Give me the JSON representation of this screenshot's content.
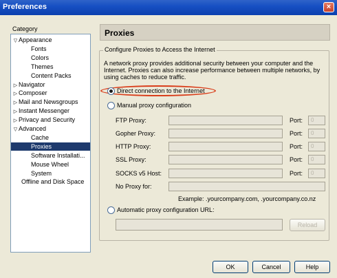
{
  "window": {
    "title": "Preferences",
    "close_glyph": "×"
  },
  "sidebar": {
    "category_label": "Category",
    "items": [
      {
        "label": "Appearance",
        "twisty": "▽"
      },
      {
        "label": "Fonts",
        "twisty": ""
      },
      {
        "label": "Colors",
        "twisty": ""
      },
      {
        "label": "Themes",
        "twisty": ""
      },
      {
        "label": "Content Packs",
        "twisty": ""
      },
      {
        "label": "Navigator",
        "twisty": "▷"
      },
      {
        "label": "Composer",
        "twisty": "▷"
      },
      {
        "label": "Mail and Newsgroups",
        "twisty": "▷"
      },
      {
        "label": "Instant Messenger",
        "twisty": "▷"
      },
      {
        "label": "Privacy and Security",
        "twisty": "▷"
      },
      {
        "label": "Advanced",
        "twisty": "▽"
      },
      {
        "label": "Cache",
        "twisty": ""
      },
      {
        "label": "Proxies",
        "twisty": ""
      },
      {
        "label": "Software Installati...",
        "twisty": ""
      },
      {
        "label": "Mouse Wheel",
        "twisty": ""
      },
      {
        "label": "System",
        "twisty": ""
      },
      {
        "label": "Offline and Disk Space",
        "twisty": ""
      }
    ],
    "selected": "Proxies"
  },
  "main": {
    "header": "Proxies",
    "group_title": "Configure Proxies to Access the Internet",
    "description": "A network proxy provides additional security between your computer and the Internet. Proxies can also increase performance between multiple networks, by using caches to reduce traffic.",
    "options": {
      "direct": "Direct connection to the Internet",
      "manual": "Manual proxy configuration",
      "auto": "Automatic proxy configuration URL:"
    },
    "selected_option": "direct",
    "proxies": [
      {
        "label": "FTP Proxy:",
        "port_label": "Port:",
        "port_value": "0"
      },
      {
        "label": "Gopher Proxy:",
        "port_label": "Port:",
        "port_value": "0"
      },
      {
        "label": "HTTP Proxy:",
        "port_label": "Port:",
        "port_value": "0"
      },
      {
        "label": "SSL Proxy:",
        "port_label": "Port:",
        "port_value": "0"
      },
      {
        "label": "SOCKS v5 Host:",
        "port_label": "Port:",
        "port_value": "0"
      }
    ],
    "no_proxy_label": "No Proxy for:",
    "example": "Example: .yourcompany.com, .yourcompany.co.nz",
    "reload_label": "Reload"
  },
  "buttons": {
    "ok": "OK",
    "cancel": "Cancel",
    "help": "Help"
  },
  "colors": {
    "title_bar": "#1750c3",
    "selection": "#1e3a6d",
    "highlight_ring": "#d93d1a"
  }
}
